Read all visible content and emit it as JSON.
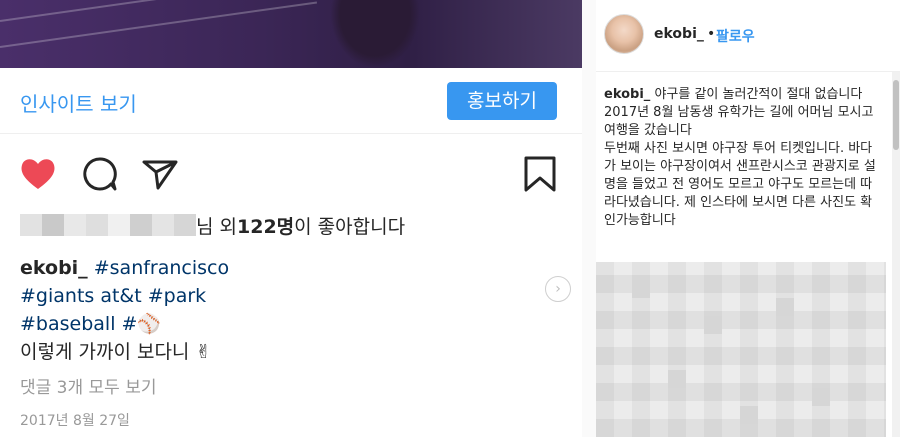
{
  "mobile": {
    "insight_label": "인사이트 보기",
    "promote_label": "홍보하기",
    "likes": {
      "suffix_prefix": "님 외 ",
      "count": "122명",
      "suffix_end": "이 좋아합니다"
    },
    "caption": {
      "user": "ekobi_",
      "line1_tag": "#sanfrancisco",
      "line2": "#giants at&t #park",
      "line3": "#baseball #⚾",
      "line4": "이렇게 가까이 보다니 ✌"
    },
    "comments_label": "댓글 3개 모두 보기",
    "date": "2017년 8월 27일",
    "icons": [
      "heart-icon",
      "comment-icon",
      "share-icon",
      "bookmark-icon",
      "chevron-right-icon"
    ],
    "colors": {
      "heart": "#ed4956",
      "link": "#3897f0",
      "tag": "#003569"
    }
  },
  "desktop": {
    "username": "ekobi_",
    "dot": "•",
    "follow_label": "팔로우",
    "post_user": "ekobi_",
    "post_text": "야구를 같이 놀러간적이 절대 없습니다\n2017년 8월 남동생 유학가는 길에 어머님 모시고 여행을 갔습니다\n두번째 사진 보시면 야구장 투어 티켓입니다. 바다가 보이는 야구장이여서 샌프란시스코 관광지로 설명을 들었고 전 영어도 모르고 야구도 모르는데 따라다녔습니다. 제 인스타에 보시면 다른 사진도 확인가능합니다"
  }
}
